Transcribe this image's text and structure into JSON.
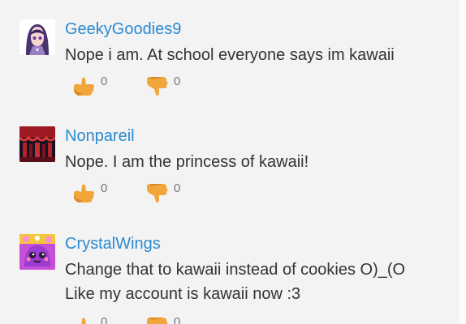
{
  "comments": [
    {
      "username": "GeekyGoodies9",
      "lines": [
        "Nope i am. At school everyone says im kawaii"
      ],
      "likes": "0",
      "dislikes": "0",
      "avatar_icon": "anime-girl-avatar-icon"
    },
    {
      "username": "Nonpareil",
      "lines": [
        "Nope. I am the princess of kawaii!"
      ],
      "likes": "0",
      "dislikes": "0",
      "avatar_icon": "red-theater-avatar-icon"
    },
    {
      "username": "CrystalWings",
      "lines": [
        "Change that to kawaii instead of cookies O)_(O",
        "Like my account is kawaii now :3"
      ],
      "likes": "0",
      "dislikes": "0",
      "avatar_icon": "purple-kawaii-avatar-icon"
    }
  ],
  "colors": {
    "username": "#2b8ad0",
    "thumb": "#f0a63a",
    "text": "#333333",
    "background": "#f3f3f3"
  }
}
